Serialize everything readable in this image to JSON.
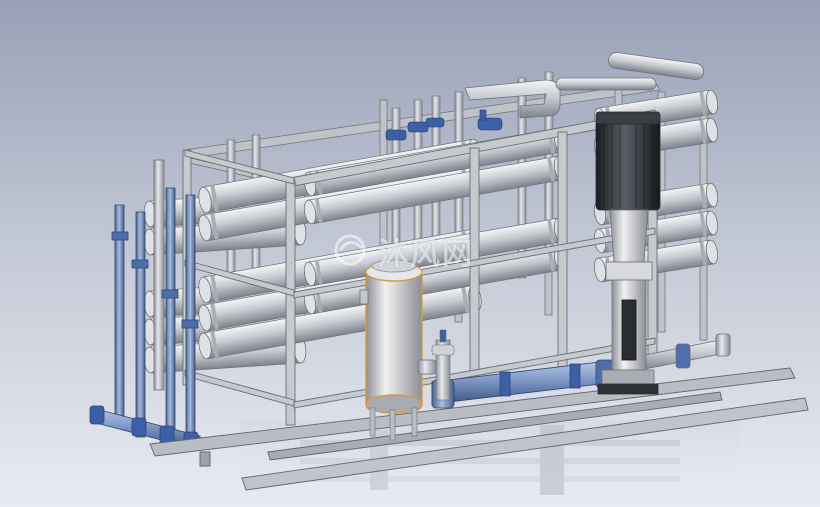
{
  "image": {
    "subject": "ro-water-treatment-skid-cad-render",
    "background_top": "#9aa2b8",
    "background_bottom": "#e6e9f0",
    "steel_color": "#c8cbd0",
    "pipe_blue": "#6f89b8",
    "filter_highlight": "#d89a3a"
  },
  "watermark": {
    "text": "沐风网"
  }
}
